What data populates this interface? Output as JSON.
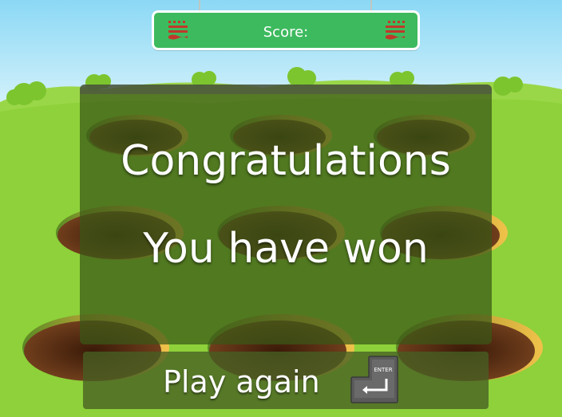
{
  "hud": {
    "score_label": "Score:"
  },
  "overlay": {
    "line1": "Congratulations",
    "line2": "You have won"
  },
  "play_again": {
    "label": "Play again",
    "key_label": "ENTER"
  },
  "colors": {
    "sky_top": "#7fd2f3",
    "grass": "#8ed13a",
    "score_bar": "#3dba5e",
    "hole": "#6a3b1c"
  },
  "icons": {
    "score_deco": "striped-flag-icon",
    "enter_key": "enter-key-icon"
  }
}
